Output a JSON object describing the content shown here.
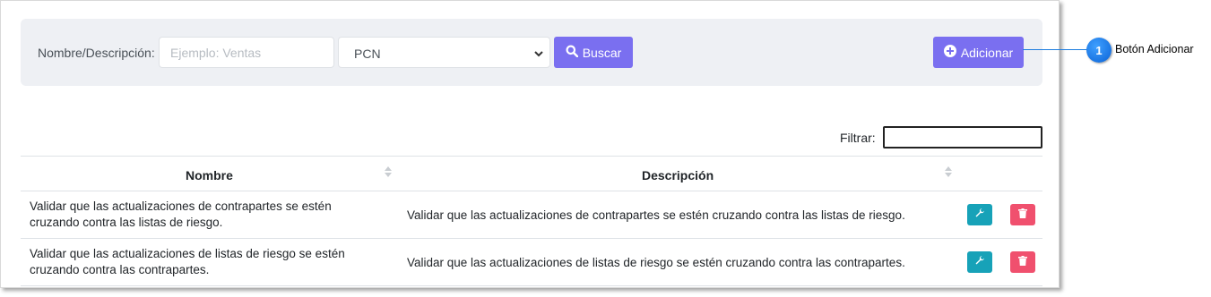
{
  "toolbar": {
    "name_label": "Nombre/Descripción:",
    "name_placeholder": "Ejemplo: Ventas",
    "select_value": "PCN",
    "search_label": "Buscar",
    "add_label": "Adicionar"
  },
  "callout": {
    "number": "1",
    "text": "Botón Adicionar"
  },
  "filter": {
    "label": "Filtrar:"
  },
  "table": {
    "headers": {
      "name": "Nombre",
      "description": "Descripción"
    },
    "rows": [
      {
        "name": "Validar que las actualizaciones de contrapartes se estén cruzando contra las listas de riesgo.",
        "description": "Validar que las actualizaciones de contrapartes se estén cruzando contra las listas de riesgo."
      },
      {
        "name": "Validar que las actualizaciones de listas de riesgo se estén cruzando contra las contrapartes.",
        "description": "Validar que las actualizaciones de listas de riesgo se estén cruzando contra las contrapartes."
      }
    ]
  },
  "colors": {
    "primary_button": "#7a6ff0",
    "edit_button": "#17a2b8",
    "delete_button": "#f0506e",
    "callout": "#1e7ddf"
  },
  "icons": {
    "search": "search-icon",
    "add": "plus-circle-icon",
    "edit": "wrench-icon",
    "delete": "trash-icon",
    "select": "chevron-down-icon"
  }
}
